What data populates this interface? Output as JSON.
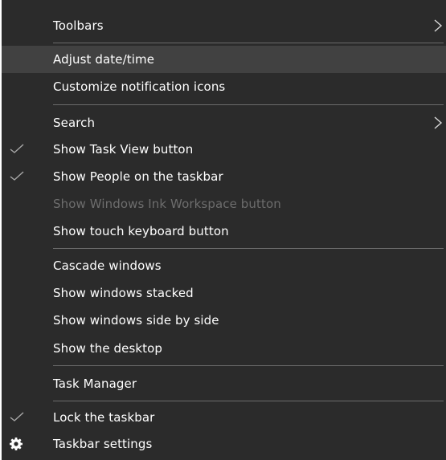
{
  "menu": {
    "toolbars": "Toolbars",
    "adjust_date_time": "Adjust date/time",
    "customize_notification_icons": "Customize notification icons",
    "search": "Search",
    "show_task_view_button": "Show Task View button",
    "show_people_on_taskbar": "Show People on the taskbar",
    "show_windows_ink_workspace_button": "Show Windows Ink Workspace button",
    "show_touch_keyboard_button": "Show touch keyboard button",
    "cascade_windows": "Cascade windows",
    "show_windows_stacked": "Show windows stacked",
    "show_windows_side_by_side": "Show windows side by side",
    "show_the_desktop": "Show the desktop",
    "task_manager": "Task Manager",
    "lock_the_taskbar": "Lock the taskbar",
    "taskbar_settings": "Taskbar settings"
  },
  "state": {
    "highlighted_item": "adjust_date_time",
    "checked": [
      "show_task_view_button",
      "show_people_on_taskbar",
      "lock_the_taskbar"
    ],
    "disabled": [
      "show_windows_ink_workspace_button"
    ]
  },
  "icons": {
    "submenu": "chevron-right-icon",
    "checked": "checkmark-icon",
    "settings": "gear-icon"
  },
  "colors": {
    "menu_background": "#2b2b2b",
    "highlight": "#414141",
    "text": "#ffffff",
    "disabled_text": "#6d6d6d",
    "separator": "#6b6b6b"
  }
}
